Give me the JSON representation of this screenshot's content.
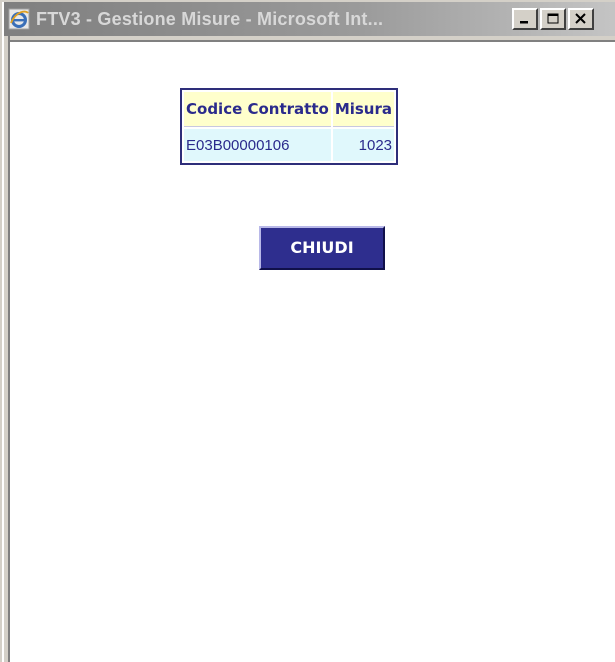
{
  "window": {
    "title": "FTV3 - Gestione Misure - Microsoft Int...",
    "controls": [
      "minimize",
      "maximize",
      "close"
    ]
  },
  "table": {
    "headers": [
      "Codice Contratto",
      "Misura"
    ],
    "rows": [
      [
        "E03B00000106",
        "1023"
      ]
    ]
  },
  "actions": {
    "close_label": "CHIUDI"
  },
  "colors": {
    "button_bg": "#2e2e8e",
    "header_bg": "#ffffcc",
    "cell_bg": "#e0f8fc",
    "text": "#2a2a8c"
  }
}
